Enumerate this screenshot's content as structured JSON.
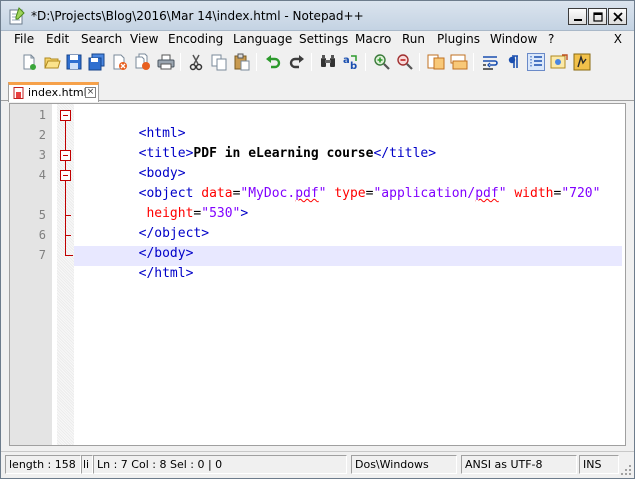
{
  "window": {
    "title": "*D:\\Projects\\Blog\\2016\\Mar 14\\index.html - Notepad++",
    "min_label": "–",
    "max_label": "□",
    "close_label": "✕"
  },
  "menu": {
    "items": [
      "File",
      "Edit",
      "Search",
      "View",
      "Encoding",
      "Language",
      "Settings",
      "Macro",
      "Run",
      "Plugins",
      "Window",
      "?"
    ],
    "close": "X"
  },
  "toolbar": {
    "icons": [
      "new-file-icon",
      "open-file-icon",
      "save-icon",
      "save-all-icon",
      "close-icon",
      "close-all-icon",
      "print-icon",
      "cut-icon",
      "copy-icon",
      "paste-icon",
      "undo-icon",
      "redo-icon",
      "find-icon",
      "replace-icon",
      "zoom-in-icon",
      "zoom-out-icon",
      "sync-vertical-icon",
      "sync-horizontal-icon",
      "word-wrap-icon",
      "show-all-chars-icon",
      "indent-guide-icon",
      "user-language-icon",
      "function-list-icon"
    ]
  },
  "tab": {
    "label": "index.html",
    "close": "×",
    "color_accent": "#f6a14a"
  },
  "editor": {
    "line_numbers": [
      "1",
      "2",
      "3",
      "4",
      "5",
      "6",
      "7"
    ],
    "current_line": 7,
    "colors": {
      "tag": "#0000c8",
      "attr": "#ff0000",
      "value": "#8000ff",
      "current_line_bg": "#e8e8ff"
    }
  },
  "code": {
    "l1": "<html>",
    "l2_open": "<title>",
    "l2_text": "PDF in eLearning course",
    "l2_close": "</title>",
    "l3": "<body>",
    "l4_tag": "<object",
    "l4_a1": "data",
    "l4_v1a": "\"MyDoc.",
    "l4_v1b": "pdf",
    "l4_v1c": "\"",
    "l4_a2": "type",
    "l4_v2a": "\"application/",
    "l4_v2b": "pdf",
    "l4_v2c": "\"",
    "l4_a3": "width",
    "l4_v3": "\"720\"",
    "l4b_a": "height",
    "l4b_v": "\"530\"",
    "l4b_end": ">",
    "l5": "</object>",
    "l6": "</body>",
    "l7": "</html>",
    "eq": "="
  },
  "status": {
    "length": "length : 158",
    "lines": "li",
    "position": "Ln : 7    Col : 8    Sel : 0 | 0",
    "eol": "Dos\\Windows",
    "encoding": "ANSI as UTF-8",
    "mode": "INS"
  }
}
